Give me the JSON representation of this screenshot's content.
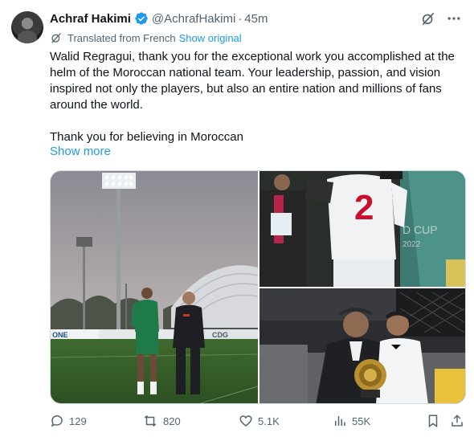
{
  "author": {
    "name": "Achraf Hakimi",
    "handle": "@AchrafHakimi",
    "separator": "·",
    "time": "45m"
  },
  "translation": {
    "label": "Translated from French",
    "link": "Show original"
  },
  "tweet": {
    "paragraphs": [
      "Walid Regragui, thank you for the exceptional work you accomplished at the helm of the Moroccan national team. Your leadership, passion, and vision inspired not only the players, but also an entire nation and millions of fans around the world.",
      "Thank you for believing in Moroccan"
    ],
    "show_more": "Show more"
  },
  "media": {
    "photo_1_sign": "ONE",
    "photo_1_sign2": "CDG",
    "photo_2_number": "2",
    "photo_2_banner": "D CUP",
    "photo_2_year": "2022"
  },
  "stats": {
    "replies": "129",
    "reposts": "820",
    "likes": "5.1K",
    "views": "55K"
  },
  "colors": {
    "accent": "#1d9bf0",
    "secondary_text": "#536471",
    "primary_text": "#0f1419"
  },
  "icons": [
    "verified-badge-icon",
    "grok-icon",
    "more-icon",
    "translate-icon",
    "reply-icon",
    "repost-icon",
    "like-icon",
    "views-icon",
    "bookmark-icon",
    "share-icon"
  ]
}
